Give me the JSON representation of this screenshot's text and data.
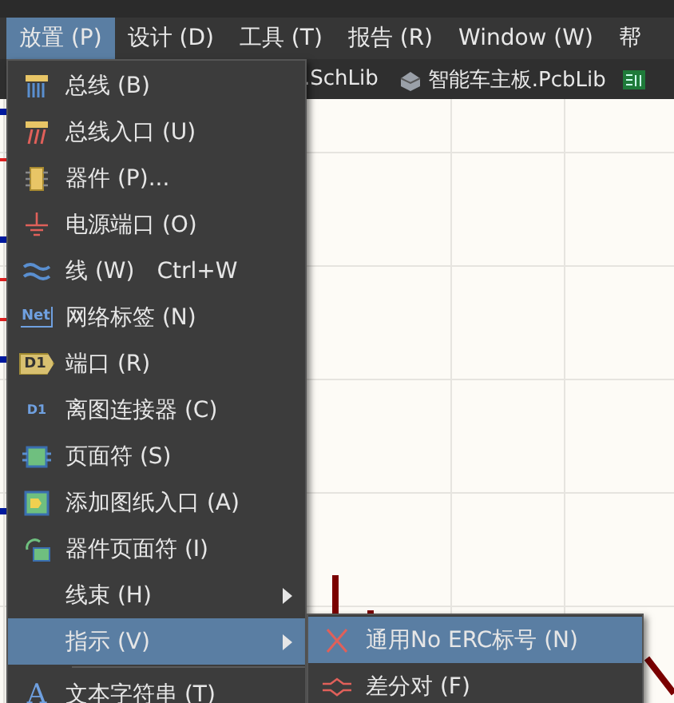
{
  "menubar": [
    {
      "label": "放置 (P)",
      "selected": true
    },
    {
      "label": "设计 (D)",
      "selected": false
    },
    {
      "label": "工具 (T)",
      "selected": false
    },
    {
      "label": "报告 (R)",
      "selected": false
    },
    {
      "label": "Window (W)",
      "selected": false
    },
    {
      "label": "帮",
      "selected": false
    }
  ],
  "tabs": [
    {
      "label": ".SchLib",
      "kind": "plain"
    },
    {
      "label": "智能车主板.PcbLib",
      "kind": "pcb-lib"
    },
    {
      "kind": "board"
    }
  ],
  "menu": {
    "items": [
      {
        "label": "总线 (B)",
        "kind": "bus",
        "selected": false
      },
      {
        "label": "总线入口 (U)",
        "kind": "bus-entry",
        "selected": false
      },
      {
        "label": "器件 (P)...",
        "kind": "part",
        "selected": false
      },
      {
        "label": "电源端口 (O)",
        "kind": "ground",
        "selected": false
      },
      {
        "label": "线 (W)",
        "kind": "wire",
        "shortcut": "Ctrl+W",
        "selected": false
      },
      {
        "label": "网络标签 (N)",
        "kind": "net-label",
        "icon_text": "Net",
        "selected": false
      },
      {
        "label": "端口 (R)",
        "kind": "port",
        "icon_text": "D1",
        "selected": false
      },
      {
        "label": "离图连接器 (C)",
        "kind": "off-sheet",
        "icon_text": "D1",
        "selected": false
      },
      {
        "label": "页面符 (S)",
        "kind": "sheet",
        "selected": false
      },
      {
        "label": "添加图纸入口 (A)",
        "kind": "sheet-entry",
        "selected": false
      },
      {
        "label": "器件页面符 (I)",
        "kind": "device-sheet",
        "selected": false
      },
      {
        "label": "线束 (H)",
        "kind": "plain",
        "submenu": true,
        "selected": false
      },
      {
        "label": "指示 (V)",
        "kind": "plain",
        "submenu": true,
        "selected": true
      },
      {
        "kind": "separator"
      },
      {
        "label": "文本字符串 (T)",
        "kind": "text",
        "icon_text": "A",
        "selected": false
      }
    ]
  },
  "submenu": {
    "items": [
      {
        "label": "通用No ERC标号 (N)",
        "kind": "no-erc",
        "selected": true
      },
      {
        "label": "差分对 (F)",
        "kind": "diff-pair",
        "selected": false
      }
    ]
  }
}
